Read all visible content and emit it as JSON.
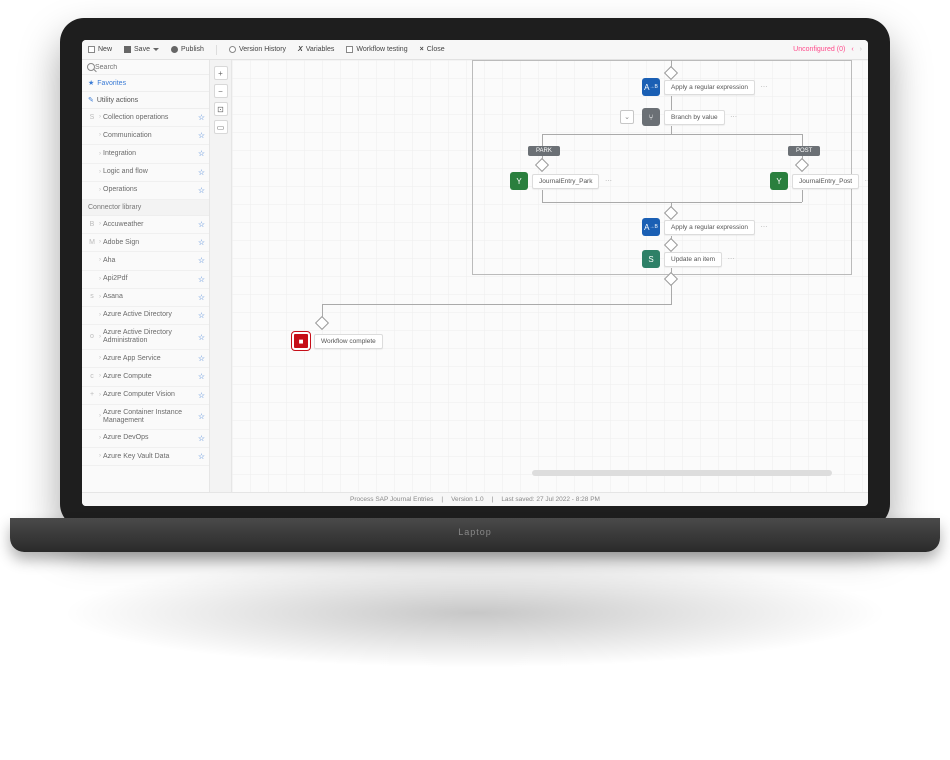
{
  "toolbar": {
    "new": "New",
    "save": "Save",
    "publish": "Publish",
    "version_history": "Version History",
    "variables": "Variables",
    "workflow_testing": "Workflow testing",
    "close": "Close",
    "status": "Unconfigured (0)"
  },
  "search": {
    "placeholder": "Search"
  },
  "sidebar": {
    "favorites": "Favorites",
    "utility_heading": "Utility actions",
    "connector_heading": "Connector library",
    "utility": [
      {
        "letter": "S",
        "label": "Collection operations"
      },
      {
        "letter": "",
        "label": "Communication"
      },
      {
        "letter": "",
        "label": "Integration"
      },
      {
        "letter": "",
        "label": "Logic and flow"
      },
      {
        "letter": "",
        "label": "Operations"
      }
    ],
    "connectors": [
      {
        "letter": "B",
        "label": "Accuweather"
      },
      {
        "letter": "M",
        "label": "Adobe Sign"
      },
      {
        "letter": "",
        "label": "Aha"
      },
      {
        "letter": "",
        "label": "Api2Pdf"
      },
      {
        "letter": "s",
        "label": "Asana"
      },
      {
        "letter": "",
        "label": "Azure Active Directory"
      },
      {
        "letter": "o",
        "label": "Azure Active Directory Administration"
      },
      {
        "letter": "",
        "label": "Azure App Service"
      },
      {
        "letter": "c",
        "label": "Azure Compute"
      },
      {
        "letter": "+",
        "label": "Azure Computer Vision"
      },
      {
        "letter": "",
        "label": "Azure Container Instance Management"
      },
      {
        "letter": "",
        "label": "Azure DevOps"
      },
      {
        "letter": "",
        "label": "Azure Key Vault Data"
      }
    ]
  },
  "canvas": {
    "apply_regex": "Apply a regular expression",
    "branch": "Branch by value",
    "park_pill": "PARK",
    "post_pill": "POST",
    "je_park": "JournalEntry_Park",
    "je_post": "JournalEntry_Post",
    "apply_regex2": "Apply a regular expression",
    "update_item": "Update an item",
    "wf_complete": "Workflow complete"
  },
  "footer": {
    "name": "Process SAP Journal Entries",
    "version": "Version 1.0",
    "saved": "Last saved: 27 Jul 2022 - 8:28 PM"
  },
  "laptop_label": "Laptop"
}
